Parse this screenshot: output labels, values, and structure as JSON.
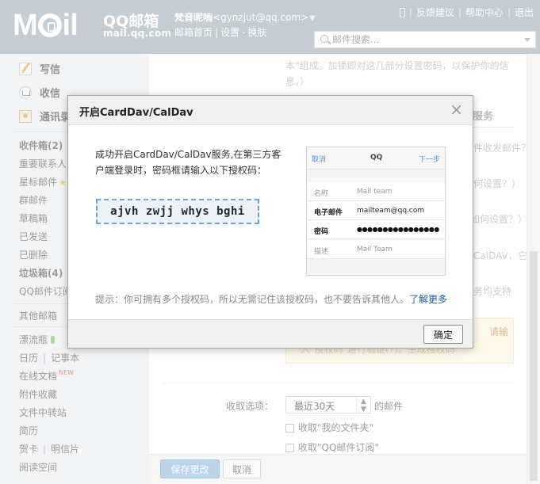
{
  "header": {
    "logo_text": "MOil",
    "logo_cn": "QQ邮箱",
    "logo_url": "mail.qq.com",
    "nickname": "梵音昵喃",
    "email": "<gynzjut@qq.com>",
    "caret": "▼",
    "links": [
      "邮箱首页",
      "设置",
      "换肤"
    ],
    "top_links": [
      "反馈建议",
      "帮助中心",
      "退出"
    ],
    "search_placeholder": "邮件搜索..."
  },
  "sidebar": {
    "write": "写信",
    "inbox": "收信",
    "contacts": "通讯录",
    "items": [
      "收件箱(2)",
      "重要联系人",
      "星标邮件",
      "群邮件",
      "草稿箱",
      "已发送",
      "已删除",
      "垃圾箱(4)",
      "QQ邮件订阅",
      "其他邮箱",
      "漂流瓶",
      "日历",
      "记事本",
      "在线文档",
      "NEW",
      "附件收藏",
      "文件中转站",
      "简历",
      "贺卡",
      "明信片",
      "阅读空间"
    ]
  },
  "main": {
    "faded_text_1": "本\"组成。加锁即对这几部分设置密码，以保护你的信",
    "faded_text_2": "息。）",
    "tab_fragment": "服务",
    "faded_right": [
      "件收发邮件？",
      "何设置？）",
      "如何设置？）",
      "CalDAV，它",
      "务均支持"
    ],
    "yellow_tip_1": "请输",
    "yellow_tip_2": "入\"授权码\"进行验证(?)。生成授权码",
    "receive_label": "收取选项：",
    "receive_value": "最近30天",
    "receive_suffix": "的邮件",
    "check_1": "收取\"我的文件夹\"",
    "check_2": "收取\"QQ邮件订阅\"",
    "save_button": "保存更改",
    "cancel_button": "取消"
  },
  "modal": {
    "title": "开启CardDav/CalDav",
    "close": "×",
    "message": "成功开启CardDav/CalDav服务,在第三方客户端登录时，密码框请输入以下授权码：",
    "auth_code": "ajvh zwjj whys bghi",
    "phone": {
      "cancel": "取消",
      "title": "QQ",
      "next": "下一步",
      "rows": [
        {
          "key": "名称",
          "value": "Mail team"
        },
        {
          "key": "电子邮件",
          "value": "mailteam@qq.com"
        },
        {
          "key": "密码",
          "value": "●●●●●●●●●●●●●●●●"
        },
        {
          "key": "描述",
          "value": "Mail Team"
        }
      ]
    },
    "tip": "提示：你可拥有多个授权码，所以无需记住该授权码，也不要告诉其他人。",
    "tip_link": "了解更多",
    "ok_button": "确定"
  }
}
